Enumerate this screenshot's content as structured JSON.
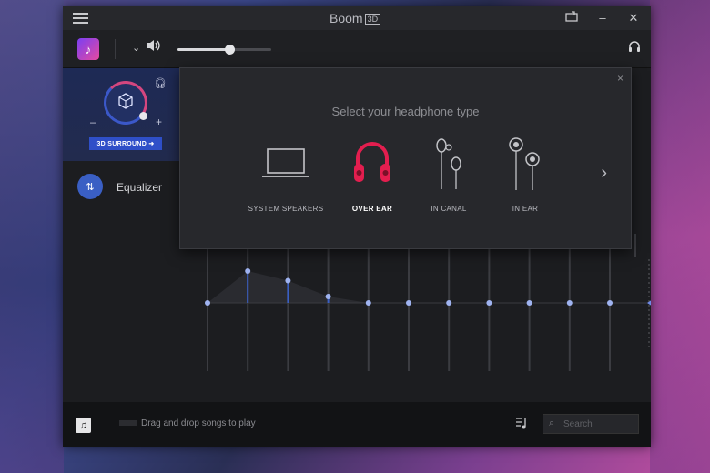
{
  "window": {
    "title": "Boom",
    "title_badge": "3D",
    "minimize": "–",
    "close": "✕"
  },
  "toolbar": {
    "volume_level": 0.55
  },
  "sidebar": {
    "surround_button": "3D SURROUND ➜",
    "minus": "–",
    "plus": "+",
    "equalizer_label": "Equalizer"
  },
  "popup": {
    "title": "Select your headphone type",
    "close": "×",
    "options": [
      {
        "label": "SYSTEM SPEAKERS",
        "selected": false
      },
      {
        "label": "OVER EAR",
        "selected": true
      },
      {
        "label": "IN CANAL",
        "selected": false
      },
      {
        "label": "IN EAR",
        "selected": false
      }
    ],
    "next": "›"
  },
  "equalizer": {
    "bands": [
      0,
      0.5,
      0.35,
      0.1,
      0,
      0,
      0,
      0,
      0,
      0,
      0
    ]
  },
  "bottom": {
    "drop_hint": "Drag and drop songs to play",
    "search_placeholder": "Search"
  },
  "colors": {
    "accent": "#e31e4f",
    "eq_blue": "#3a5fc4"
  }
}
